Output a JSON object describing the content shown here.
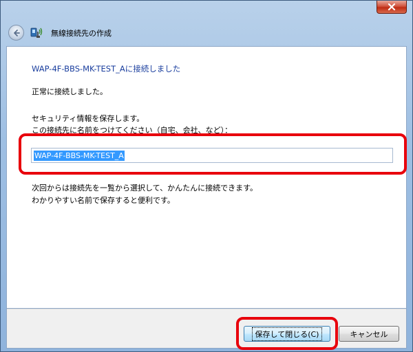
{
  "wizard": {
    "title": "無線接続先の作成"
  },
  "content": {
    "heading": "WAP-4F-BBS-MK-TEST_Aに接続しました",
    "connected_text": "正常に接続しました。",
    "save_info_line1": "セキュリティ情報を保存します。",
    "save_info_line2": "この接続先に名前をつけてください（自宅、会社、など）：",
    "name_value": "WAP-4F-BBS-MK-TEST_A",
    "hint_line1": "次回からは接続先を一覧から選択して、かんたんに接続できます。",
    "hint_line2": "わかりやすい名前で保存すると便利です。"
  },
  "buttons": {
    "save_close_label": "保存して閉じる(C)",
    "cancel_label": "キャンセル"
  },
  "colors": {
    "heading": "#1a3e9e",
    "highlight": "#e8000c",
    "selection": "#3399ff"
  }
}
